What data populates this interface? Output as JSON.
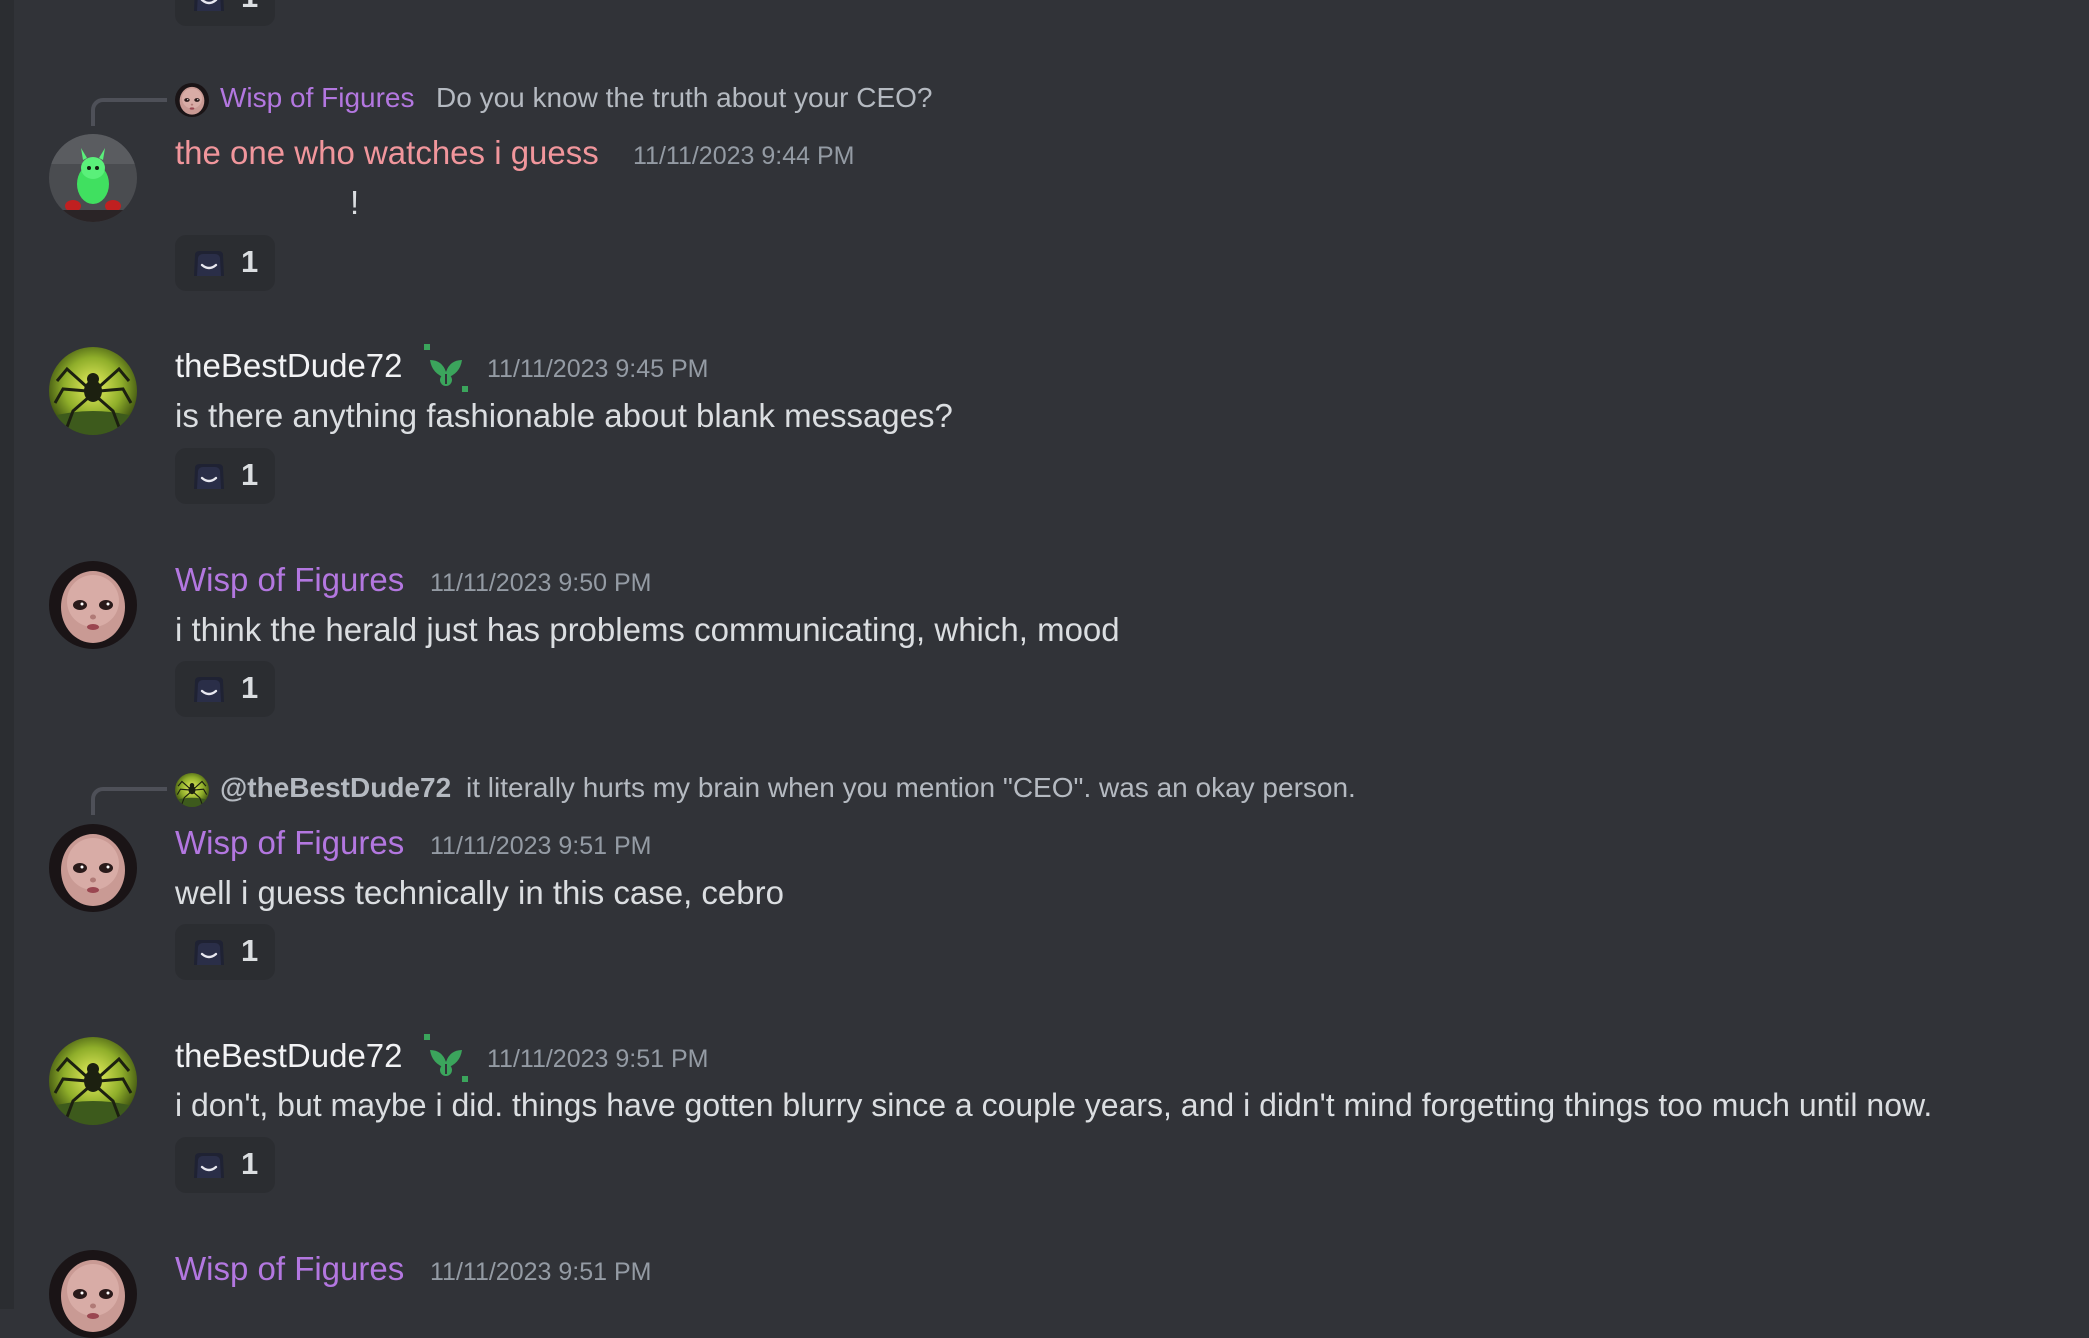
{
  "colors": {
    "background": "#313338",
    "wisp_name": "#b377e0",
    "watcher_name": "#f1969c",
    "dude_name": "#f2f3f5",
    "badge_green": "#3ba55c"
  },
  "icons": {
    "reaction_emoji": "smiling-face-icon",
    "badge": "leaf-badge-icon"
  },
  "messages": [
    {
      "reply": {
        "author": "Wisp of Figures",
        "text": "Do you know the truth about your CEO?"
      },
      "author": "the one who watches i guess",
      "timestamp": "11/11/2023 9:44 PM",
      "content": "!",
      "reaction_count": "1"
    },
    {
      "author": "theBestDude72",
      "timestamp": "11/11/2023 9:45 PM",
      "content": "is there anything fashionable about blank messages?",
      "reaction_count": "1"
    },
    {
      "author": "Wisp of Figures",
      "timestamp": "11/11/2023 9:50 PM",
      "content": "i think the herald just has problems communicating, which, mood",
      "reaction_count": "1"
    },
    {
      "reply": {
        "author": "@theBestDude72",
        "text": "it literally hurts my brain when you mention \"CEO\". was an okay person."
      },
      "author": "Wisp of Figures",
      "timestamp": "11/11/2023 9:51 PM",
      "content": "well i guess technically in this case, cebro",
      "reaction_count": "1"
    },
    {
      "author": "theBestDude72",
      "timestamp": "11/11/2023 9:51 PM",
      "content": "i don't, but maybe i did. things have gotten blurry since a couple years, and i didn't mind forgetting things too much until now.",
      "reaction_count": "1"
    },
    {
      "author": "Wisp of Figures",
      "timestamp": "11/11/2023 9:51 PM"
    }
  ],
  "top_reaction_count": "1"
}
